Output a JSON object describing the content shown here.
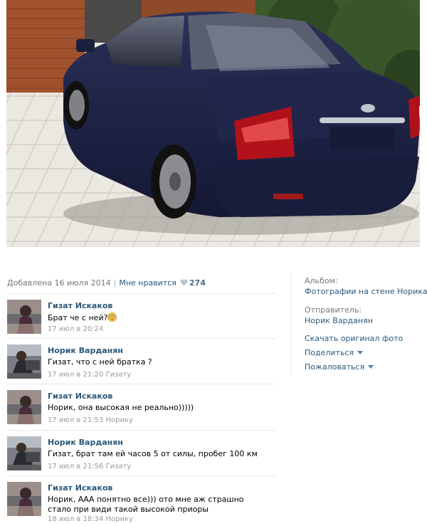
{
  "photo": {
    "alt": "photo-of-car"
  },
  "meta": {
    "added": "Добавлена 16 июля 2014",
    "separator": "|",
    "likes_label": "Мне нравится",
    "likes_count": "274"
  },
  "comments": [
    {
      "author": "Гизат Искаков",
      "text": "Брат че с ней?",
      "date": "17 июл в 20:24",
      "reply_to": ""
    },
    {
      "author": "Норик Варданян",
      "text": "Гизат, что с ней братка ?",
      "date": "17 июл в 21:20",
      "reply_to": "Гизату"
    },
    {
      "author": "Гизат Искаков",
      "text": "Норик, она высокая не реально)))))",
      "date": "17 июл в 21:53",
      "reply_to": "Норику"
    },
    {
      "author": "Норик Варданян",
      "text": "Гизат, брат там ей часов 5 от силы, пробег 100 км",
      "date": "17 июл в 21:56",
      "reply_to": "Гизату"
    },
    {
      "author": "Гизат Искаков",
      "text": "Норик, ААА понятно все))) ото мне аж страшно стало при види такой высокой приоры",
      "date": "18 июл в 18:34",
      "reply_to": "Норику"
    }
  ],
  "sidebar": {
    "album_label": "Альбом:",
    "album_value": "Фотографии на стене Норика",
    "sender_label": "Отправитель:",
    "sender_value": "Норик Варданян",
    "download": "Скачать оригинал фото",
    "share": "Поделиться",
    "report": "Пожаловаться"
  },
  "colors": {
    "link": "#2b587a",
    "muted": "#777777",
    "divider": "#e7e8ec",
    "car": "#1d2447"
  }
}
